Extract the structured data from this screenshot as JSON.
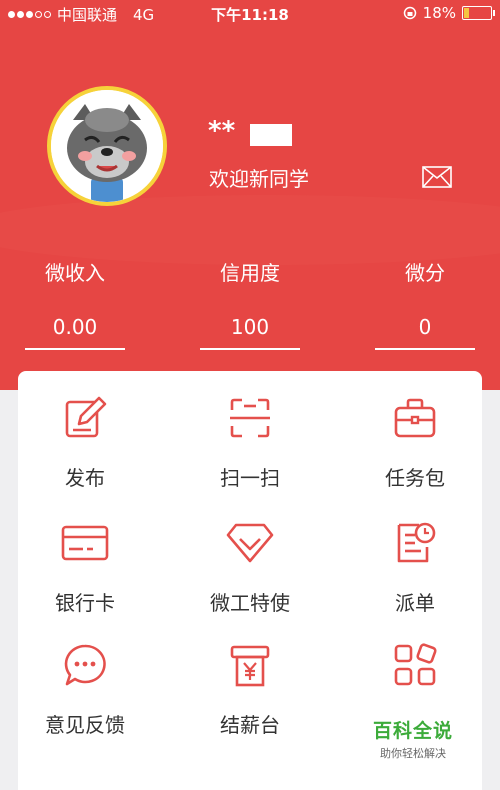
{
  "status_bar": {
    "carrier": "中国联通",
    "network": "4G",
    "time": "下午11:18",
    "battery": "18%",
    "battery_level": 0.18
  },
  "profile": {
    "username": "**",
    "welcome": "欢迎新同学"
  },
  "stats": [
    {
      "label": "微收入",
      "value": "0.00"
    },
    {
      "label": "信用度",
      "value": "100"
    },
    {
      "label": "微分",
      "value": "0"
    }
  ],
  "menu": [
    {
      "label": "发布",
      "icon": "edit-icon"
    },
    {
      "label": "扫一扫",
      "icon": "scan-icon"
    },
    {
      "label": "任务包",
      "icon": "briefcase-icon"
    },
    {
      "label": "银行卡",
      "icon": "bank-card-icon"
    },
    {
      "label": "微工特使",
      "icon": "diamond-icon"
    },
    {
      "label": "派单",
      "icon": "dispatch-order-icon"
    },
    {
      "label": "意见反馈",
      "icon": "chat-bubble-icon"
    },
    {
      "label": "结薪台",
      "icon": "salary-icon"
    }
  ],
  "watermark": {
    "title": "百科全说",
    "subtitle": "助你轻松解决"
  },
  "colors": {
    "brand_red": "#e64644",
    "icon_red": "#e4504c",
    "watermark_green": "#3cab3a"
  }
}
